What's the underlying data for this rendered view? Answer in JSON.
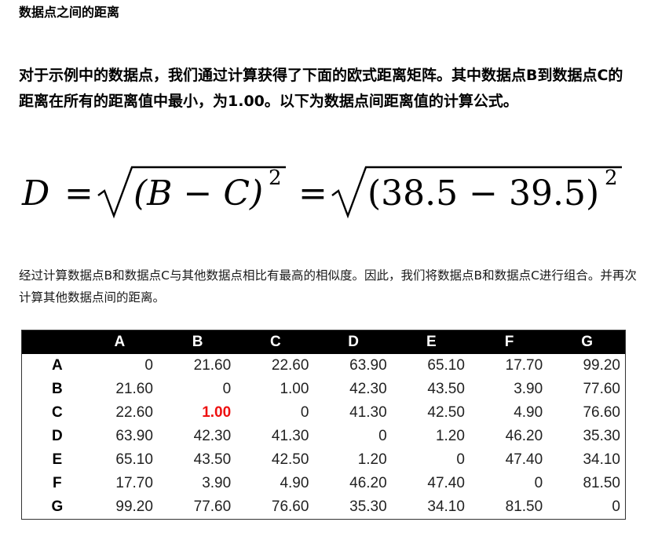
{
  "section_title": "数据点之间的距离",
  "intro_paragraph": "对于示例中的数据点，我们通过计算获得了下面的欧式距离矩阵。其中数据点B到数据点C的距离在所有的距离值中最小，为1.00。以下为数据点间距离值的计算公式。",
  "formula": {
    "lhs": "D",
    "equals": "=",
    "middle_expr": "(B − C)",
    "right_expr": "(38.5 − 39.5)",
    "exponent": "2"
  },
  "result_paragraph": "经过计算数据点B和数据点C与其他数据点相比有最高的相似度。因此，我们将数据点B和数据点C进行组合。并再次计算其他数据点间的距离。",
  "matrix": {
    "columns": [
      "A",
      "B",
      "C",
      "D",
      "E",
      "F",
      "G"
    ],
    "rows": [
      {
        "label": "A",
        "cells": [
          "0",
          "21.60",
          "22.60",
          "63.90",
          "65.10",
          "17.70",
          "99.20"
        ]
      },
      {
        "label": "B",
        "cells": [
          "21.60",
          "0",
          "1.00",
          "42.30",
          "43.50",
          "3.90",
          "77.60"
        ]
      },
      {
        "label": "C",
        "cells": [
          "22.60",
          "1.00",
          "0",
          "41.30",
          "42.50",
          "4.90",
          "76.60"
        ]
      },
      {
        "label": "D",
        "cells": [
          "63.90",
          "42.30",
          "41.30",
          "0",
          "1.20",
          "46.20",
          "35.30"
        ]
      },
      {
        "label": "E",
        "cells": [
          "65.10",
          "43.50",
          "42.50",
          "1.20",
          "0",
          "47.40",
          "34.10"
        ]
      },
      {
        "label": "F",
        "cells": [
          "17.70",
          "3.90",
          "4.90",
          "46.20",
          "47.40",
          "0",
          "81.50"
        ]
      },
      {
        "label": "G",
        "cells": [
          "99.20",
          "77.60",
          "76.60",
          "35.30",
          "34.10",
          "81.50",
          "0"
        ]
      }
    ],
    "highlight": {
      "row": "C",
      "column": "B",
      "color": "#ee1111"
    }
  }
}
